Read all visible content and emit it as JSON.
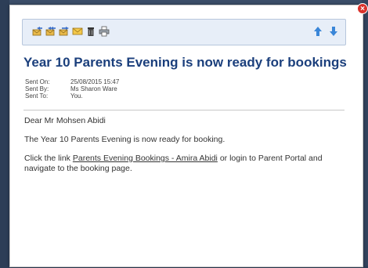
{
  "toolbar": {
    "icons": [
      "reply-icon",
      "reply-all-icon",
      "forward-icon",
      "mark-unread-icon",
      "delete-icon",
      "print-icon"
    ],
    "nav": [
      "previous-arrow-icon",
      "next-arrow-icon"
    ]
  },
  "message": {
    "subject": "Year 10 Parents Evening is now ready for bookings",
    "sent_on_label": "Sent On:",
    "sent_on": "25/08/2015 15:47",
    "sent_by_label": "Sent By:",
    "sent_by": "Ms Sharon Ware",
    "sent_to_label": "Sent To:",
    "sent_to": "You.",
    "greeting": "Dear Mr Mohsen Abidi",
    "line1": "The Year 10 Parents Evening is now ready for booking.",
    "line2_pre": "Click the link",
    "link_text": "Parents Evening Bookings - Amira Abidi",
    "line2_post": "or login to Parent Portal and navigate to the booking page."
  },
  "colors": {
    "subject": "#1b3f7c",
    "nav_arrows": "#3a86d8",
    "close": "#d9322b"
  }
}
